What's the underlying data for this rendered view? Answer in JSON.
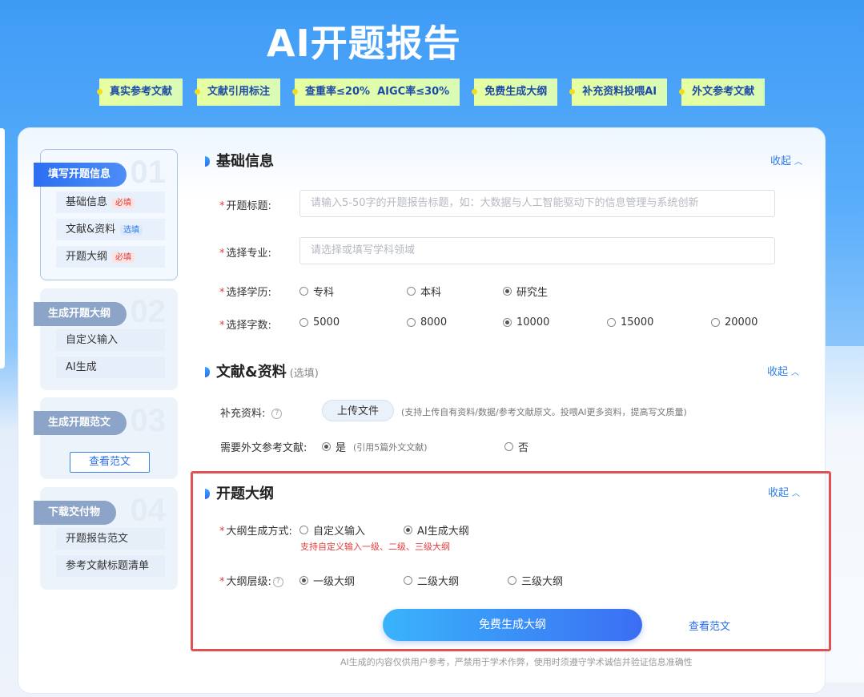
{
  "hero": {
    "title": "AI开题报告",
    "features": [
      "真实参考文献",
      "文献引用标注",
      "查重率≤20%  AIGC率≤30%",
      "免费生成大纲",
      "补充资料投喂AI",
      "外文参考文献"
    ]
  },
  "sidebar": {
    "steps": [
      {
        "num": "01",
        "tab": "填写开题信息",
        "items": [
          {
            "label": "基础信息",
            "badge": "必填"
          },
          {
            "label": "文献&资料",
            "badge": "选填"
          },
          {
            "label": "开题大纲",
            "badge": "必填"
          }
        ]
      },
      {
        "num": "02",
        "tab": "生成开题大纲",
        "items": [
          {
            "label": "自定义输入"
          },
          {
            "label": "AI生成"
          }
        ]
      },
      {
        "num": "03",
        "tab": "生成开题范文",
        "button": "查看范文"
      },
      {
        "num": "04",
        "tab": "下载交付物",
        "items": [
          {
            "label": "开题报告范文"
          },
          {
            "label": "参考文献标题清单"
          }
        ]
      }
    ]
  },
  "basic": {
    "title": "基础信息",
    "collapse": "收起",
    "topic_label": "开题标题:",
    "topic_placeholder": "请输入5-50字的开题报告标题，如：大数据与人工智能驱动下的信息管理与系统创新",
    "major_label": "选择专业:",
    "major_placeholder": "请选择或填写学科领域",
    "degree_label": "选择学历:",
    "degree_options": [
      "专科",
      "本科",
      "研究生"
    ],
    "degree_selected": "研究生",
    "words_label": "选择字数:",
    "words_options": [
      "5000",
      "8000",
      "10000",
      "15000",
      "20000"
    ],
    "words_selected": "10000"
  },
  "literature": {
    "title": "文献&资料",
    "subtitle": "(选填)",
    "collapse": "收起",
    "supplement_label": "补充资料:",
    "upload_label": "上传文件",
    "upload_hint": "(支持上传自有资料/数据/参考文献原文。投喂AI更多资料，提高写文质量)",
    "foreign_label": "需要外文参考文献:",
    "foreign_yes": "是",
    "foreign_yes_hint": "(引用5篇外文文献)",
    "foreign_no": "否",
    "foreign_selected": "是"
  },
  "outline": {
    "title": "开题大纲",
    "collapse": "收起",
    "method_label": "大纲生成方式:",
    "method_options": [
      "自定义输入",
      "AI生成大纲"
    ],
    "method_selected": "AI生成大纲",
    "method_note": "支持自定义输入一级、二级、三级大纲",
    "level_label": "大纲层级:",
    "level_options": [
      "一级大纲",
      "二级大纲",
      "三级大纲"
    ],
    "level_selected": "一级大纲",
    "generate_button": "免费生成大纲",
    "view_sample": "查看范文"
  },
  "footer": {
    "disclaimer": "AI生成的内容仅供用户参考，严禁用于学术作弊，使用时须遵守学术诚信并验证信息准确性"
  },
  "colors": {
    "primary": "#2b6ff2",
    "required": "#e43b3b",
    "highlight_border": "#e05252",
    "feature_bg": "#e7ffa1"
  }
}
